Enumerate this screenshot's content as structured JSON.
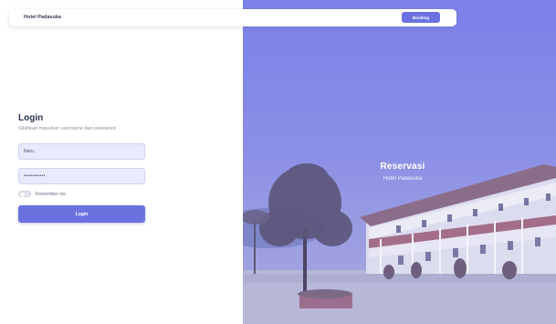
{
  "navbar": {
    "brand": "Hotel Padasuka",
    "button_label": "Booking"
  },
  "login": {
    "title": "Login",
    "subtitle": "Silahkan masukan username dan password",
    "username_value": "Naru",
    "password_value": "••••••••••••",
    "remember_label": "Remember me",
    "submit_label": "Login"
  },
  "hero": {
    "title": "Reservasi",
    "subtitle": "Hotel Padasuka"
  },
  "colors": {
    "accent": "#6b72e0",
    "hero_tint": "#7c80e8",
    "field_bg": "#e8ebfb"
  },
  "icons": {
    "toggle": "toggle-switch-icon"
  }
}
